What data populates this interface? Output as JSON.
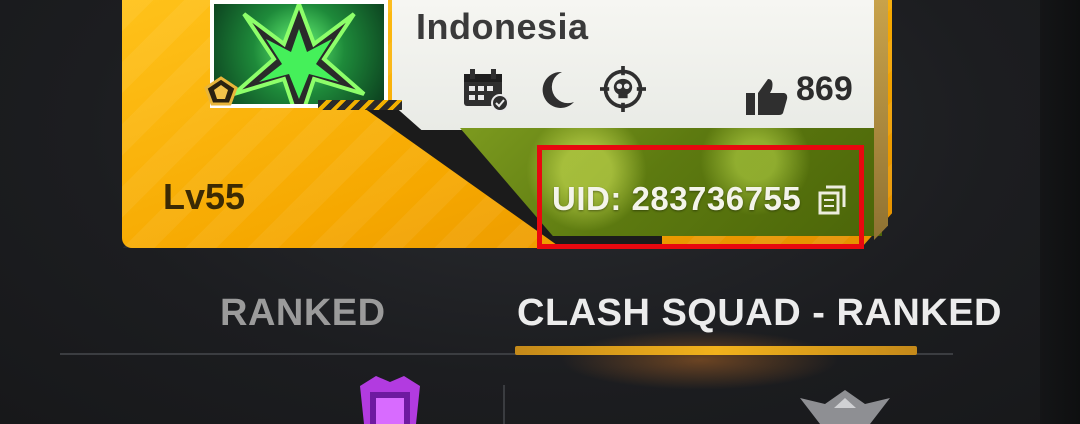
{
  "profile": {
    "country": "Indonesia",
    "likes": "869",
    "level": "Lv55",
    "uid": "UID: 283736755"
  },
  "icons": {
    "avatar": "green-x-emblem-icon",
    "rank_badge": "gold-badge-icon",
    "calendar": "calendar-icon",
    "moon": "moon-icon",
    "target": "skull-crosshair-icon",
    "like": "thumbs-up-icon",
    "copy": "copy-icon"
  },
  "tabs": [
    {
      "label": "RANKED",
      "active": false
    },
    {
      "label": "CLASH SQUAD - RANKED",
      "active": true
    }
  ],
  "colors": {
    "card_accent": "#f6a800",
    "highlight": "#e8080f",
    "active_tab_underline": "#f2b21c"
  }
}
